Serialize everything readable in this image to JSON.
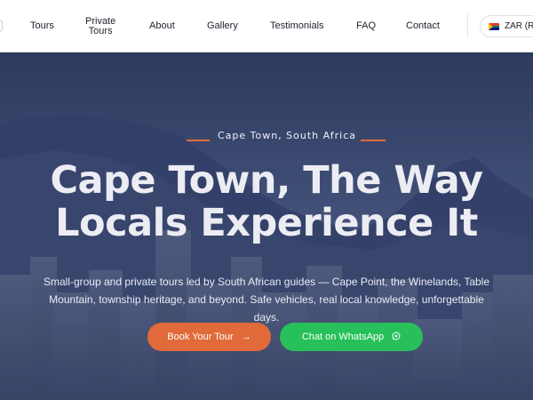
{
  "nav": {
    "items": [
      {
        "label_line1": "Tours",
        "label_line2": ""
      },
      {
        "label_line1": "Private",
        "label_line2": "Tours"
      },
      {
        "label_line1": "About",
        "label_line2": ""
      },
      {
        "label_line1": "Gallery",
        "label_line2": ""
      },
      {
        "label_line1": "Testimonials",
        "label_line2": ""
      },
      {
        "label_line1": "FAQ",
        "label_line2": ""
      },
      {
        "label_line1": "Contact",
        "label_line2": ""
      }
    ],
    "currency": {
      "label": "ZAR (R)",
      "flag_icon": "south-africa-flag-icon"
    }
  },
  "hero": {
    "eyebrow": "Cape Town, South Africa",
    "headline_line1": "Cape Town, The Way",
    "headline_line2": "Locals Experience It",
    "subtext": "Small-group and private tours led by South African guides — Cape Point, the Winelands, Table Mountain, township heritage, and beyond. Safe vehicles, real local knowledge, unforgettable days.",
    "book_button": {
      "label": "Book Your Tour",
      "icon": "arrow-right-icon"
    },
    "whatsapp_button": {
      "label": "Chat on WhatsApp",
      "icon": "whatsapp-icon"
    }
  },
  "colors": {
    "accent_orange": "#e06a3a",
    "whatsapp_green": "#27c05a",
    "hero_overlay": "#3e4a6e",
    "nav_text": "#1f1f2e"
  }
}
